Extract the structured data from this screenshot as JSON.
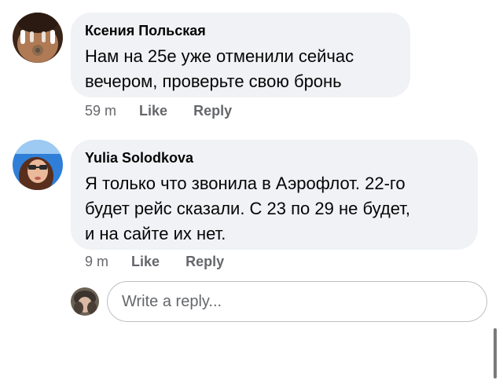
{
  "comments": [
    {
      "author": "Ксения Польская",
      "text_lines": [
        "Нам на 25е уже отменили сейчас",
        "вечером, проверьте свою бронь"
      ],
      "time": "59 m",
      "like_label": "Like",
      "reply_label": "Reply"
    },
    {
      "author": "Yulia  Solodkova",
      "text_lines": [
        "Я только что звонила в Аэрофлот. 22-го",
        "будет рейс сказали. С 23 по 29 не будет,",
        "и на сайте их нет."
      ],
      "time": "9 m",
      "like_label": "Like",
      "reply_label": "Reply"
    }
  ],
  "reply": {
    "placeholder": "Write a reply..."
  },
  "colors": {
    "bubble_bg": "#f0f2f5",
    "meta_text": "#65676b",
    "input_border": "#bcc0c4"
  }
}
